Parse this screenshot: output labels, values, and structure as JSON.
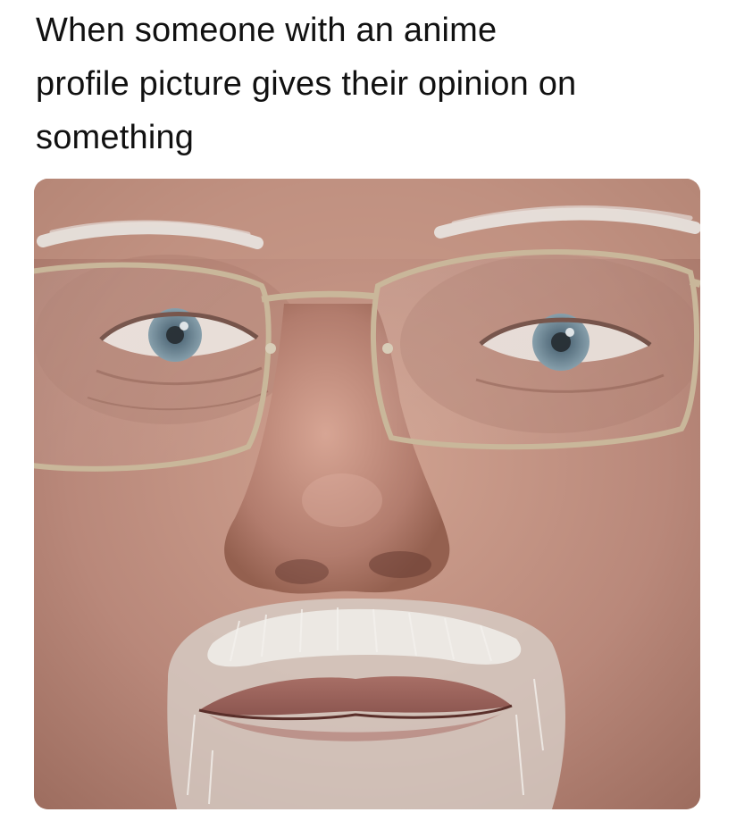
{
  "meme": {
    "caption": "When someone with an anime\nprofile picture gives their opinion on\nsomething"
  },
  "photo": {
    "subject": "close-up-face-with-glasses",
    "colors": {
      "skin": "#c29583",
      "skin_shadow": "#9e6f5e",
      "beard": "#e8e4df",
      "frames": "#c8b79a",
      "iris": "#6a8494"
    }
  }
}
